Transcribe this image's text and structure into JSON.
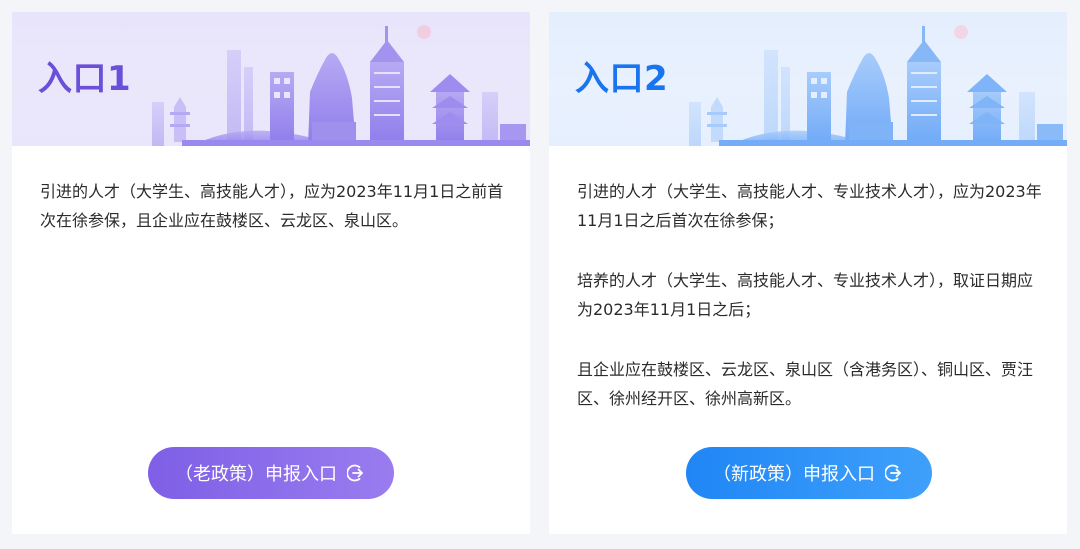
{
  "cards": [
    {
      "title": "入口1",
      "paragraphs": [
        "引进的人才（大学生、高技能人才），应为2023年11月1日之前首次在徐参保，且企业应在鼓楼区、云龙区、泉山区。"
      ],
      "button_label": "（老政策）申报入口",
      "button_icon": "arrow-circle-right-icon",
      "accent_color": "#6a4fd8"
    },
    {
      "title": "入口2",
      "paragraphs": [
        "引进的人才（大学生、高技能人才、专业技术人才），应为2023年11月1日之后首次在徐参保；",
        "培养的人才（大学生、高技能人才、专业技术人才），取证日期应为2023年11月1日之后；",
        "且企业应在鼓楼区、云龙区、泉山区（含港务区）、铜山区、贾汪区、徐州经开区、徐州高新区。"
      ],
      "button_label": "（新政策）申报入口",
      "button_icon": "arrow-circle-right-icon",
      "accent_color": "#1875ef"
    }
  ]
}
